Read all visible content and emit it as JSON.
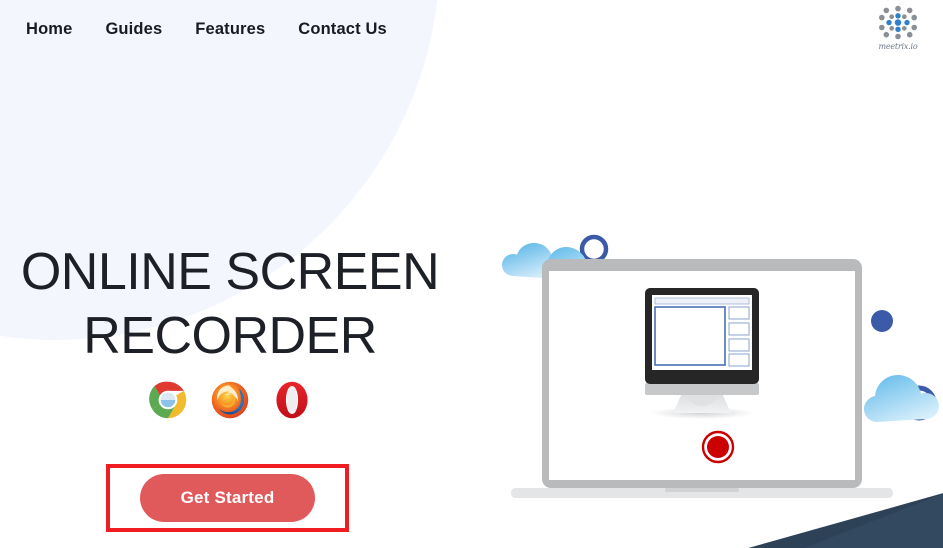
{
  "nav": {
    "items": [
      {
        "label": "Home"
      },
      {
        "label": "Guides"
      },
      {
        "label": "Features"
      },
      {
        "label": "Contact Us"
      }
    ]
  },
  "brand": {
    "wordmark": "meetrix.io",
    "logo_icon": "dot-grid-logo-icon",
    "dot_gray": "#8a8f95",
    "dot_blue": "#2f7fd1"
  },
  "hero": {
    "title_line1": "ONLINE SCREEN",
    "title_line2": "RECORDER",
    "title_color": "#1d2026",
    "supported_browsers": [
      {
        "name": "Chrome",
        "icon": "chrome-icon"
      },
      {
        "name": "Firefox",
        "icon": "firefox-icon"
      },
      {
        "name": "Opera",
        "icon": "opera-icon"
      }
    ]
  },
  "cta": {
    "label": "Get Started",
    "button_color": "#e05a5c",
    "highlight_color": "#ef1d21"
  },
  "illustration": {
    "name": "laptop-screen-recording-illustration",
    "record_button_color": "#cc0000",
    "cloud_color": "#5bb4e5",
    "ring_color": "#3b5ba9",
    "laptop_color": "#b8babc"
  },
  "decor": {
    "blob_color": "#f3f7fd",
    "corner_color": "#2e4257"
  }
}
